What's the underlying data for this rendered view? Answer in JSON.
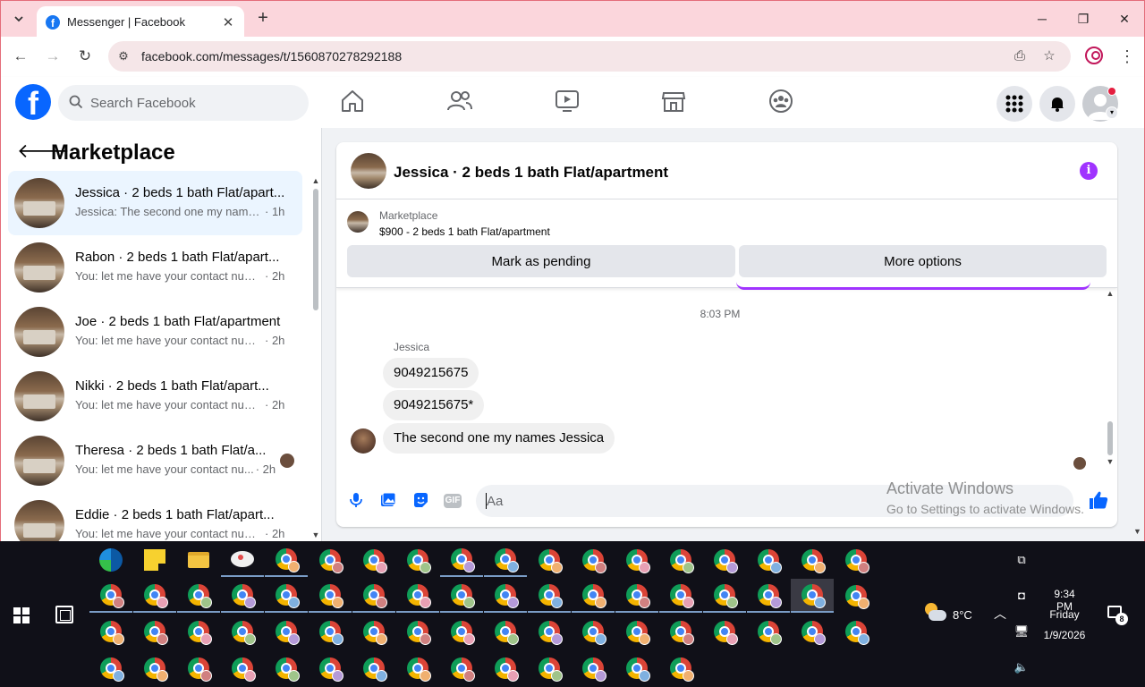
{
  "browser": {
    "tab_title": "Messenger | Facebook",
    "url": "facebook.com/messages/t/1560870278292188",
    "tab_search_icon": "chevron-down-icon",
    "new_tab_symbol": "+"
  },
  "fb_header": {
    "logo_letter": "f",
    "search_placeholder": "Search Facebook",
    "nav_icons": [
      "home-icon",
      "friends-icon",
      "watch-icon",
      "marketplace-icon",
      "groups-icon"
    ],
    "right_icons": [
      "menu-grid-icon",
      "notifications-bell-icon",
      "profile-avatar"
    ]
  },
  "left_panel": {
    "title": "Marketplace",
    "conversations": [
      {
        "name": "Jessica · 2 beds 1 bath Flat/apart...",
        "preview": "Jessica: The second one my names ...",
        "time": "· 1h",
        "active": true
      },
      {
        "name": "Rabon · 2 beds 1 bath Flat/apart...",
        "preview": "You: let me have your contact num...",
        "time": "· 2h",
        "active": false
      },
      {
        "name": "Joe · 2 beds 1 bath Flat/apartment",
        "preview": "You: let me have your contact num...",
        "time": "· 2h",
        "active": false
      },
      {
        "name": "Nikki · 2 beds 1 bath Flat/apart...",
        "preview": "You: let me have your contact num...",
        "time": "· 2h",
        "active": false
      },
      {
        "name": "Theresa · 2 beds 1 bath Flat/a...",
        "preview": "You: let me have your contact nu...",
        "time": "· 2h",
        "active": false
      },
      {
        "name": "Eddie · 2 beds 1 bath Flat/apart...",
        "preview": "You: let me have your contact num...",
        "time": "· 2h",
        "active": false
      }
    ]
  },
  "chat": {
    "title": "Jessica · 2 beds 1 bath Flat/apartment",
    "info_symbol": "i",
    "listing_label": "Marketplace",
    "listing_price": "$900 - 2 beds 1 bath Flat/apartment",
    "buttons": {
      "pending": "Mark as pending",
      "more": "More options"
    },
    "timestamp": "8:03 PM",
    "sender": "Jessica",
    "messages": [
      "9049215675",
      "9049215675*",
      "The second one my names Jessica"
    ],
    "composer_placeholder": "Aa",
    "composer_icons": [
      "microphone-icon",
      "photo-icon",
      "sticker-icon",
      "gif-icon"
    ],
    "gif_label": "GIF"
  },
  "watermark": {
    "line1": "Activate Windows",
    "line2": "Go to Settings to activate Windows."
  },
  "taskbar": {
    "weather": "8°C",
    "time": "9:34 PM",
    "day": "Friday",
    "date": "1/9/2026",
    "notification_count": "8",
    "badge_colors": [
      "#e8a0b4",
      "#9fc48a",
      "#b49ad8",
      "#7fb0e0",
      "#f0b070",
      "#d08080"
    ]
  },
  "colors": {
    "fb_blue": "#0866ff",
    "accent_purple": "#a033ff",
    "active_conversation_bg": "#ebf5ff"
  }
}
